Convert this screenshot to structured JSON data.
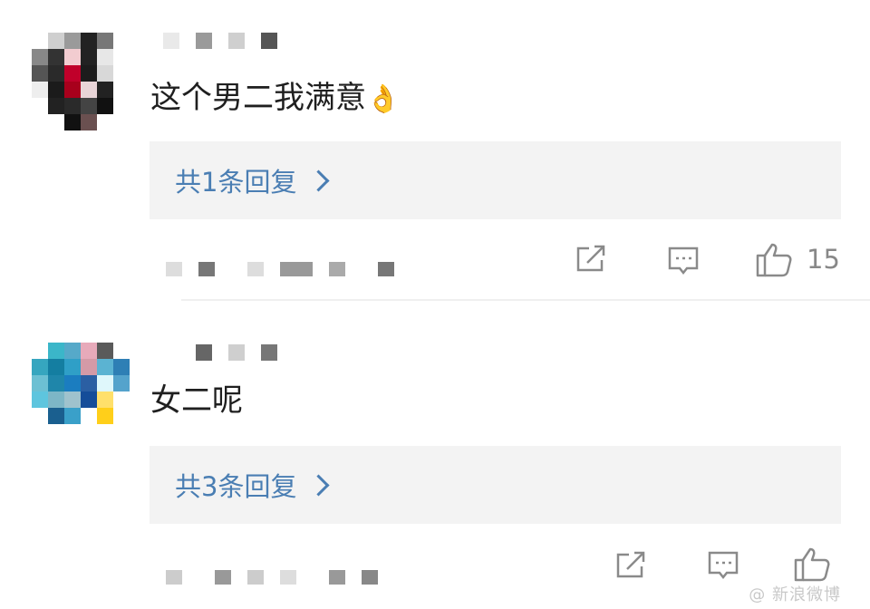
{
  "comments": [
    {
      "text": "这个男二我满意",
      "emoji": "👌",
      "reply_label": "共1条回复",
      "like_count": "15",
      "avatar_colors": [
        "#ffffff",
        "#cfcfcf",
        "#9a9a9a",
        "#222",
        "#777",
        "#fff",
        "#888",
        "#333",
        "#f2ccd0",
        "#222",
        "#e7e7e7",
        "#fff",
        "#555",
        "#2a2a2a",
        "#c0002a",
        "#1c1c1c",
        "#d8d8d8",
        "#fff",
        "#eee",
        "#1b1b1b",
        "#a8001c",
        "#e8d4d7",
        "#222",
        "#fff",
        "#fff",
        "#222",
        "#2a2a2a",
        "#444",
        "#111",
        "#fff",
        "#fff",
        "#fff",
        "#111",
        "#6a5050",
        "#fff",
        "#fff"
      ]
    },
    {
      "text": "女二呢",
      "reply_label": "共3条回复",
      "avatar_colors": [
        "#fff",
        "#3bb6c9",
        "#56a9c9",
        "#e7aaba",
        "#5a5a5a",
        "#fff",
        "#36a6bf",
        "#147ea1",
        "#2f9fc7",
        "#d49aa7",
        "#5bb3d2",
        "#2e7fb5",
        "#6cc0d3",
        "#1f86aa",
        "#1b7dc0",
        "#2b5fa3",
        "#dff7fb",
        "#54a3cc",
        "#5ec5de",
        "#7db6c6",
        "#9fc2cd",
        "#154d99",
        "#ffe06b",
        "#fff",
        "#fff",
        "#1a5f8f",
        "#3aa0c9",
        "#fff",
        "#ffcf1a",
        "#fff",
        "#fff",
        "#fff",
        "#fff",
        "#fff",
        "#fff",
        "#fff"
      ]
    }
  ],
  "watermark": "@ 新浪微博"
}
